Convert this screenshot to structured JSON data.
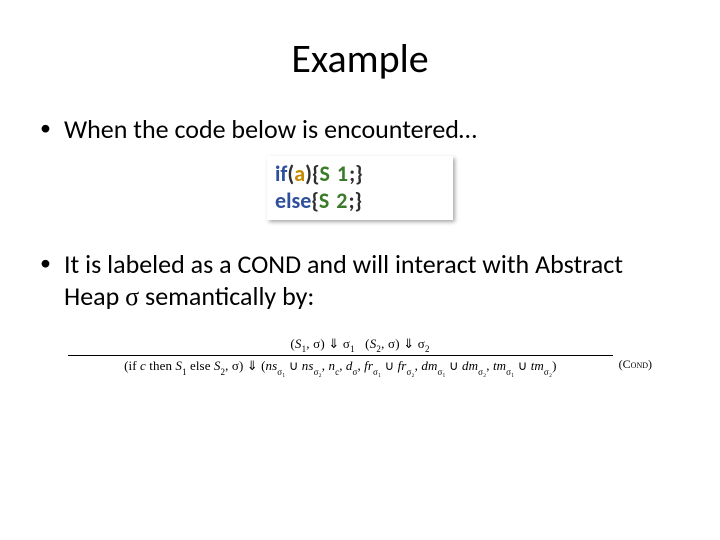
{
  "title": "Example",
  "bullets": {
    "b1": "When the code below is encountered…",
    "b2_pre": "It is labeled as a COND and will interact with Abstract Heap ",
    "b2_sigma": "σ",
    "b2_post": " semantically by:"
  },
  "code": {
    "line1": {
      "if": "if",
      "lp": "(",
      "a": "a",
      "rp": ")",
      "sp": " ",
      "lb": "{",
      "s": " S 1",
      "semi": ";",
      "sp2": " ",
      "rb": "}"
    },
    "line2": {
      "else": "else",
      "sp": " ",
      "lb": "{",
      "s": " S 2",
      "semi": ";",
      "sp2": " ",
      "rb": "}"
    }
  },
  "rule": {
    "top": "(S₁, σ) ⇓ σ₁    (S₂, σ) ⇓ σ₂",
    "bottom": "(if c then S₁ else S₂, σ) ⇓ (ns_{σ₁} ∪ ns_{σ₂}, n_c, d_σ, fr_{σ₁} ∪ fr_{σ₂}, dm_{σ₁} ∪ dm_{σ₂}, tm_{σ₁} ∪ tm_{σ₂})",
    "label": "(Cond)"
  }
}
